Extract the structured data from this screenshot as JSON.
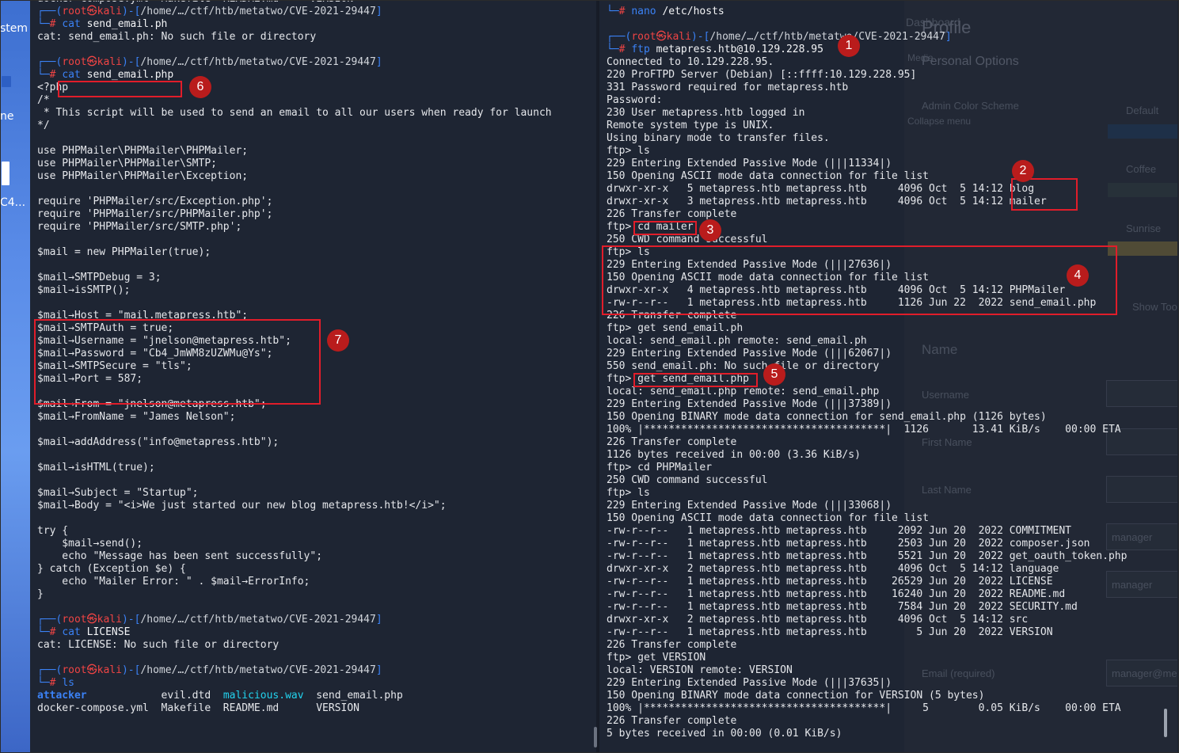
{
  "desktop": {
    "labels": [
      "stem",
      "ne",
      "C4..."
    ]
  },
  "left_terminal": {
    "lines": [
      [
        {
          "t": "docker-compose.yml  Makefile  README.md     VERSION",
          "c": "dim"
        }
      ],
      [
        {
          "t": "┌──(",
          "c": "blue"
        },
        {
          "t": "root㉿kali",
          "c": "red"
        },
        {
          "t": ")-[",
          "c": "blue"
        },
        {
          "t": "/home/…/ctf/htb/metatwo/CVE-2021-29447",
          "c": "path"
        },
        {
          "t": "]",
          "c": "blue"
        }
      ],
      [
        {
          "t": "└─",
          "c": "blue"
        },
        {
          "t": "# ",
          "c": "red"
        },
        {
          "t": "cat",
          "c": "cmd"
        },
        {
          "t": " send_email.ph",
          "c": "white"
        }
      ],
      [
        {
          "t": "cat: send_email.ph: No such file or directory",
          "c": ""
        }
      ],
      [
        {
          "t": "",
          "c": ""
        }
      ],
      [
        {
          "t": "┌──(",
          "c": "blue"
        },
        {
          "t": "root㉿kali",
          "c": "red"
        },
        {
          "t": ")-[",
          "c": "blue"
        },
        {
          "t": "/home/…/ctf/htb/metatwo/CVE-2021-29447",
          "c": "path"
        },
        {
          "t": "]",
          "c": "blue"
        }
      ],
      [
        {
          "t": "└─",
          "c": "blue"
        },
        {
          "t": "# ",
          "c": "red"
        },
        {
          "t": "cat",
          "c": "cmd"
        },
        {
          "t": " send_email.php",
          "c": "white"
        }
      ],
      [
        {
          "t": "<?php",
          "c": ""
        }
      ],
      [
        {
          "t": "/*",
          "c": ""
        }
      ],
      [
        {
          "t": " * This script will be used to send an email to all our users when ready for launch",
          "c": ""
        }
      ],
      [
        {
          "t": "*/",
          "c": ""
        }
      ],
      [
        {
          "t": "",
          "c": ""
        }
      ],
      [
        {
          "t": "use PHPMailer\\PHPMailer\\PHPMailer;",
          "c": ""
        }
      ],
      [
        {
          "t": "use PHPMailer\\PHPMailer\\SMTP;",
          "c": ""
        }
      ],
      [
        {
          "t": "use PHPMailer\\PHPMailer\\Exception;",
          "c": ""
        }
      ],
      [
        {
          "t": "",
          "c": ""
        }
      ],
      [
        {
          "t": "require 'PHPMailer/src/Exception.php';",
          "c": ""
        }
      ],
      [
        {
          "t": "require 'PHPMailer/src/PHPMailer.php';",
          "c": ""
        }
      ],
      [
        {
          "t": "require 'PHPMailer/src/SMTP.php';",
          "c": ""
        }
      ],
      [
        {
          "t": "",
          "c": ""
        }
      ],
      [
        {
          "t": "$mail = new PHPMailer(true);",
          "c": ""
        }
      ],
      [
        {
          "t": "",
          "c": ""
        }
      ],
      [
        {
          "t": "$mail→SMTPDebug = 3;",
          "c": ""
        }
      ],
      [
        {
          "t": "$mail→isSMTP();",
          "c": ""
        }
      ],
      [
        {
          "t": "",
          "c": ""
        }
      ],
      [
        {
          "t": "$mail→Host = \"mail.metapress.htb\";",
          "c": ""
        }
      ],
      [
        {
          "t": "$mail→SMTPAuth = true;",
          "c": ""
        }
      ],
      [
        {
          "t": "$mail→Username = \"jnelson@metapress.htb\";",
          "c": ""
        }
      ],
      [
        {
          "t": "$mail→Password = \"Cb4_JmWM8zUZWMu@Ys\";",
          "c": ""
        }
      ],
      [
        {
          "t": "$mail→SMTPSecure = \"tls\";",
          "c": ""
        }
      ],
      [
        {
          "t": "$mail→Port = 587;",
          "c": ""
        }
      ],
      [
        {
          "t": "",
          "c": ""
        }
      ],
      [
        {
          "t": "$mail→From = \"jnelson@metapress.htb\";",
          "c": ""
        }
      ],
      [
        {
          "t": "$mail→FromName = \"James Nelson\";",
          "c": ""
        }
      ],
      [
        {
          "t": "",
          "c": ""
        }
      ],
      [
        {
          "t": "$mail→addAddress(\"info@metapress.htb\");",
          "c": ""
        }
      ],
      [
        {
          "t": "",
          "c": ""
        }
      ],
      [
        {
          "t": "$mail→isHTML(true);",
          "c": ""
        }
      ],
      [
        {
          "t": "",
          "c": ""
        }
      ],
      [
        {
          "t": "$mail→Subject = \"Startup\";",
          "c": ""
        }
      ],
      [
        {
          "t": "$mail→Body = \"<i>We just started our new blog metapress.htb!</i>\";",
          "c": ""
        }
      ],
      [
        {
          "t": "",
          "c": ""
        }
      ],
      [
        {
          "t": "try {",
          "c": ""
        }
      ],
      [
        {
          "t": "    $mail→send();",
          "c": ""
        }
      ],
      [
        {
          "t": "    echo \"Message has been sent successfully\";",
          "c": ""
        }
      ],
      [
        {
          "t": "} catch (Exception $e) {",
          "c": ""
        }
      ],
      [
        {
          "t": "    echo \"Mailer Error: \" . $mail→ErrorInfo;",
          "c": ""
        }
      ],
      [
        {
          "t": "}",
          "c": ""
        }
      ],
      [
        {
          "t": "",
          "c": ""
        }
      ],
      [
        {
          "t": "┌──(",
          "c": "blue"
        },
        {
          "t": "root㉿kali",
          "c": "red"
        },
        {
          "t": ")-[",
          "c": "blue"
        },
        {
          "t": "/home/…/ctf/htb/metatwo/CVE-2021-29447",
          "c": "path"
        },
        {
          "t": "]",
          "c": "blue"
        }
      ],
      [
        {
          "t": "└─",
          "c": "blue"
        },
        {
          "t": "# ",
          "c": "red"
        },
        {
          "t": "cat",
          "c": "cmd"
        },
        {
          "t": " LICENSE",
          "c": "white"
        }
      ],
      [
        {
          "t": "cat: LICENSE: No such file or directory",
          "c": ""
        }
      ],
      [
        {
          "t": "",
          "c": ""
        }
      ],
      [
        {
          "t": "┌──(",
          "c": "blue"
        },
        {
          "t": "root㉿kali",
          "c": "red"
        },
        {
          "t": ")-[",
          "c": "blue"
        },
        {
          "t": "/home/…/ctf/htb/metatwo/CVE-2021-29447",
          "c": "path"
        },
        {
          "t": "]",
          "c": "blue"
        }
      ],
      [
        {
          "t": "└─",
          "c": "blue"
        },
        {
          "t": "# ",
          "c": "red"
        },
        {
          "t": "ls",
          "c": "cmd"
        }
      ],
      [
        {
          "t": "attacker",
          "c": "dir"
        },
        {
          "t": "            evil.dtd  ",
          "c": ""
        },
        {
          "t": "malicious.wav",
          "c": "media"
        },
        {
          "t": "  send_email.php",
          "c": ""
        }
      ],
      [
        {
          "t": "docker-compose.yml  Makefile  README.md      VERSION",
          "c": ""
        }
      ]
    ]
  },
  "right_terminal": {
    "lines": [
      [
        {
          "t": "└─",
          "c": "blue"
        },
        {
          "t": "# ",
          "c": "red"
        },
        {
          "t": "nano",
          "c": "cmd"
        },
        {
          "t": " /etc/hosts",
          "c": "white"
        }
      ],
      [
        {
          "t": "",
          "c": ""
        }
      ],
      [
        {
          "t": "┌──(",
          "c": "blue"
        },
        {
          "t": "root㉿kali",
          "c": "red"
        },
        {
          "t": ")-[",
          "c": "blue"
        },
        {
          "t": "/home/…/ctf/htb/metatwo/CVE-2021-29447",
          "c": "path"
        },
        {
          "t": "]",
          "c": "blue"
        }
      ],
      [
        {
          "t": "└─",
          "c": "blue"
        },
        {
          "t": "# ",
          "c": "red"
        },
        {
          "t": "ftp",
          "c": "cmd"
        },
        {
          "t": " metapress.htb@10.129.228.95",
          "c": "white"
        }
      ],
      [
        {
          "t": "Connected to 10.129.228.95.",
          "c": ""
        }
      ],
      [
        {
          "t": "220 ProFTPD Server (Debian) [::ffff:10.129.228.95]",
          "c": ""
        }
      ],
      [
        {
          "t": "331 Password required for metapress.htb",
          "c": ""
        }
      ],
      [
        {
          "t": "Password:",
          "c": ""
        }
      ],
      [
        {
          "t": "230 User metapress.htb logged in",
          "c": ""
        }
      ],
      [
        {
          "t": "Remote system type is UNIX.",
          "c": ""
        }
      ],
      [
        {
          "t": "Using binary mode to transfer files.",
          "c": ""
        }
      ],
      [
        {
          "t": "ftp> ls",
          "c": ""
        }
      ],
      [
        {
          "t": "229 Entering Extended Passive Mode (|||11334|)",
          "c": ""
        }
      ],
      [
        {
          "t": "150 Opening ASCII mode data connection for file list",
          "c": ""
        }
      ],
      [
        {
          "t": "drwxr-xr-x   5 metapress.htb metapress.htb     4096 Oct  5 14:12 blog",
          "c": ""
        }
      ],
      [
        {
          "t": "drwxr-xr-x   3 metapress.htb metapress.htb     4096 Oct  5 14:12 mailer",
          "c": ""
        }
      ],
      [
        {
          "t": "226 Transfer complete",
          "c": ""
        }
      ],
      [
        {
          "t": "ftp> cd mailer",
          "c": ""
        }
      ],
      [
        {
          "t": "250 CWD command successful",
          "c": ""
        }
      ],
      [
        {
          "t": "ftp> ls",
          "c": ""
        }
      ],
      [
        {
          "t": "229 Entering Extended Passive Mode (|||27636|)",
          "c": ""
        }
      ],
      [
        {
          "t": "150 Opening ASCII mode data connection for file list",
          "c": ""
        }
      ],
      [
        {
          "t": "drwxr-xr-x   4 metapress.htb metapress.htb     4096 Oct  5 14:12 PHPMailer",
          "c": ""
        }
      ],
      [
        {
          "t": "-rw-r--r--   1 metapress.htb metapress.htb     1126 Jun 22  2022 send_email.php",
          "c": ""
        }
      ],
      [
        {
          "t": "226 Transfer complete",
          "c": ""
        }
      ],
      [
        {
          "t": "ftp> get send_email.ph",
          "c": ""
        }
      ],
      [
        {
          "t": "local: send_email.ph remote: send_email.ph",
          "c": ""
        }
      ],
      [
        {
          "t": "229 Entering Extended Passive Mode (|||62067|)",
          "c": ""
        }
      ],
      [
        {
          "t": "550 send_email.ph: No such file or directory",
          "c": ""
        }
      ],
      [
        {
          "t": "ftp> get send_email.php",
          "c": ""
        }
      ],
      [
        {
          "t": "local: send_email.php remote: send_email.php",
          "c": ""
        }
      ],
      [
        {
          "t": "229 Entering Extended Passive Mode (|||37389|)",
          "c": ""
        }
      ],
      [
        {
          "t": "150 Opening BINARY mode data connection for send_email.php (1126 bytes)",
          "c": ""
        }
      ],
      [
        {
          "t": "100% |***************************************|  1126       13.41 KiB/s    00:00 ETA",
          "c": ""
        }
      ],
      [
        {
          "t": "226 Transfer complete",
          "c": ""
        }
      ],
      [
        {
          "t": "1126 bytes received in 00:00 (3.36 KiB/s)",
          "c": ""
        }
      ],
      [
        {
          "t": "ftp> cd PHPMailer",
          "c": ""
        }
      ],
      [
        {
          "t": "250 CWD command successful",
          "c": ""
        }
      ],
      [
        {
          "t": "ftp> ls",
          "c": ""
        }
      ],
      [
        {
          "t": "229 Entering Extended Passive Mode (|||33068|)",
          "c": ""
        }
      ],
      [
        {
          "t": "150 Opening ASCII mode data connection for file list",
          "c": ""
        }
      ],
      [
        {
          "t": "-rw-r--r--   1 metapress.htb metapress.htb     2092 Jun 20  2022 COMMITMENT",
          "c": ""
        }
      ],
      [
        {
          "t": "-rw-r--r--   1 metapress.htb metapress.htb     2503 Jun 20  2022 composer.json",
          "c": ""
        }
      ],
      [
        {
          "t": "-rw-r--r--   1 metapress.htb metapress.htb     5521 Jun 20  2022 get_oauth_token.php",
          "c": ""
        }
      ],
      [
        {
          "t": "drwxr-xr-x   2 metapress.htb metapress.htb     4096 Oct  5 14:12 language",
          "c": ""
        }
      ],
      [
        {
          "t": "-rw-r--r--   1 metapress.htb metapress.htb    26529 Jun 20  2022 LICENSE",
          "c": ""
        }
      ],
      [
        {
          "t": "-rw-r--r--   1 metapress.htb metapress.htb    16240 Jun 20  2022 README.md",
          "c": ""
        }
      ],
      [
        {
          "t": "-rw-r--r--   1 metapress.htb metapress.htb     7584 Jun 20  2022 SECURITY.md",
          "c": ""
        }
      ],
      [
        {
          "t": "drwxr-xr-x   2 metapress.htb metapress.htb     4096 Oct  5 14:12 src",
          "c": ""
        }
      ],
      [
        {
          "t": "-rw-r--r--   1 metapress.htb metapress.htb        5 Jun 20  2022 VERSION",
          "c": ""
        }
      ],
      [
        {
          "t": "226 Transfer complete",
          "c": ""
        }
      ],
      [
        {
          "t": "ftp> get VERSION",
          "c": ""
        }
      ],
      [
        {
          "t": "local: VERSION remote: VERSION",
          "c": ""
        }
      ],
      [
        {
          "t": "229 Entering Extended Passive Mode (|||37635|)",
          "c": ""
        }
      ],
      [
        {
          "t": "150 Opening BINARY mode data connection for VERSION (5 bytes)",
          "c": ""
        }
      ],
      [
        {
          "t": "100% |***************************************|     5        0.05 KiB/s    00:00 ETA",
          "c": ""
        }
      ],
      [
        {
          "t": "226 Transfer complete",
          "c": ""
        }
      ],
      [
        {
          "t": "5 bytes received in 00:00 (0.01 KiB/s)",
          "c": ""
        }
      ]
    ]
  },
  "background_page": {
    "texts": [
      "Dashboard",
      "Profile",
      "Personal Options",
      "Media",
      "Admin Color Scheme",
      "Default",
      "Coffee",
      "Sunrise",
      "Collapse menu",
      "Show Toolbar",
      "Name",
      "Username",
      "manager",
      "First Name",
      "Last Name",
      "Email (required)",
      "manager@meta"
    ],
    "colors": [
      "#1f3a5a",
      "#2f3b3f",
      "#7a6a3a",
      "#8a6a20"
    ]
  },
  "annotations": [
    "1",
    "2",
    "3",
    "4",
    "5",
    "6",
    "7"
  ],
  "colors": {
    "terminal_bg": "#1e2533",
    "prompt_blue": "#3b82f6",
    "prompt_red": "#ef4444",
    "highlight_red": "#e11d2a",
    "badge_red": "#b91c1c",
    "dir_blue": "#3b82f6",
    "media_cyan": "#22d3ee"
  }
}
